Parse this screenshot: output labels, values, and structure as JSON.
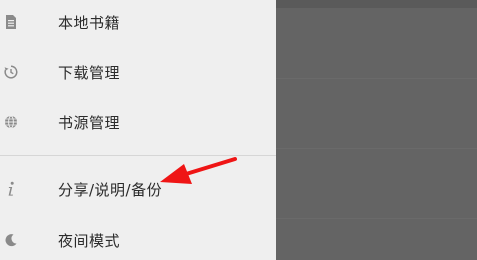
{
  "drawer": {
    "items": [
      {
        "label": "本地书籍",
        "icon": "file-icon"
      },
      {
        "label": "下载管理",
        "icon": "history-icon"
      },
      {
        "label": "书源管理",
        "icon": "globe-icon"
      },
      {
        "label": "分享/说明/备份",
        "icon": "info-icon"
      },
      {
        "label": "夜间模式",
        "icon": "moon-icon"
      }
    ]
  },
  "colors": {
    "drawer_background": "#efefef",
    "scrim": "#646464",
    "annotation_arrow": "#ef1515"
  }
}
